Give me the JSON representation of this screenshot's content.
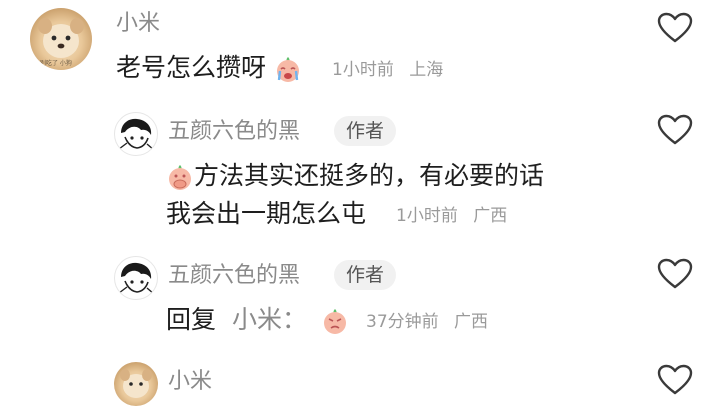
{
  "comments": [
    {
      "user": "小米",
      "text": "老号怎么攒呀",
      "emoji": "crying-face-emoji",
      "time": "1小时前",
      "location": "上海",
      "avatar_text": "别吃了 小狗"
    },
    {
      "user": "五颜六色的黑",
      "badge": "作者",
      "emoji": "covering-mouth-face-emoji",
      "text_line1": "方法其实还挺多的，有必要的话",
      "text_line2": "我会出一期怎么屯",
      "time": "1小时前",
      "location": "广西"
    },
    {
      "user": "五颜六色的黑",
      "badge": "作者",
      "reply_prefix": "回复",
      "reply_to": "小米：",
      "emoji": "pouting-face-emoji",
      "time": "37分钟前",
      "location": "广西"
    },
    {
      "user": "小米"
    }
  ],
  "icons": {
    "like": "heart-outline-icon"
  },
  "colors": {
    "username": "#8a8a8a",
    "text": "#1e1e1e",
    "meta": "#9a9a9a",
    "badge_bg": "#f1f1f1",
    "emoji_face": "#f7b9a6",
    "emoji_leaf": "#5fbf6a"
  }
}
